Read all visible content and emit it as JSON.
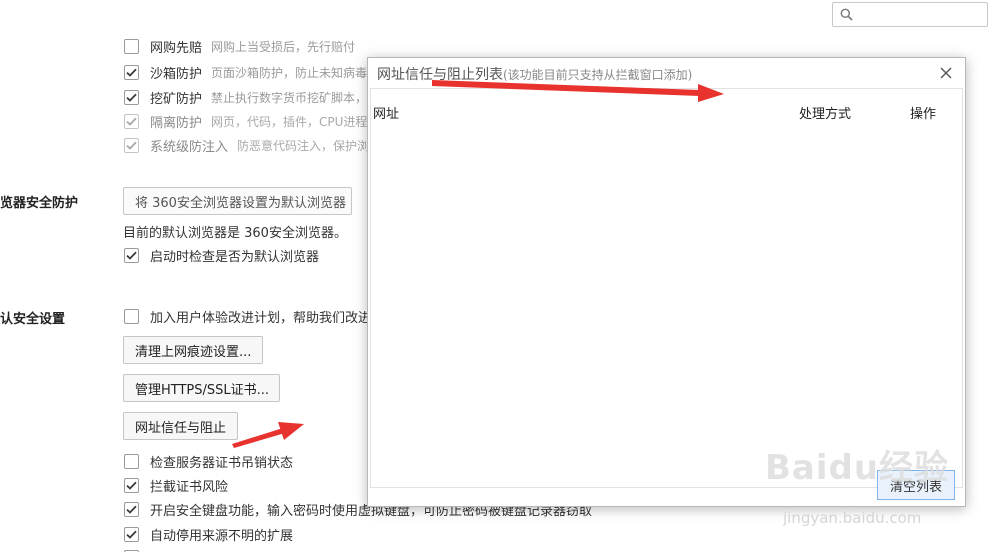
{
  "search": {
    "value": ""
  },
  "options_top": [
    {
      "name": "网购先赔",
      "desc": "网购上当受损后，先行赔付",
      "checked": false,
      "disabled": false
    },
    {
      "name": "沙箱防护",
      "desc": "页面沙箱防护，防止未知病毒",
      "checked": true,
      "disabled": false
    },
    {
      "name": "挖矿防护",
      "desc": "禁止执行数字货币挖矿脚本，",
      "checked": true,
      "disabled": false
    },
    {
      "name": "隔离防护",
      "desc": "网页，代码，插件，CPU进程",
      "checked": true,
      "disabled": true
    },
    {
      "name": "系统级防注入",
      "desc": "防恶意代码注入，保护浏",
      "checked": true,
      "disabled": true
    }
  ],
  "browser_section": {
    "title": "览器安全防护",
    "set_default_button": "将 360安全浏览器设置为默认浏览器",
    "status_text": "目前的默认浏览器是 360安全浏览器。",
    "check_on_start": {
      "label": "启动时检查是否为默认浏览器",
      "checked": true
    }
  },
  "privacy_section": {
    "title": "认安全设置",
    "join_program": {
      "label": "加入用户体验改进计划，帮助我们改进",
      "checked": false
    },
    "clear_traces_button": "清理上网痕迹设置...",
    "manage_ssl_button": "管理HTTPS/SSL证书...",
    "url_trust_button": "网址信任与阻止",
    "checks": [
      {
        "label": "检查服务器证书吊销状态",
        "checked": false
      },
      {
        "label": "拦截证书风险",
        "checked": true
      },
      {
        "label": "开启安全键盘功能，输入密码时使用虚拟键盘，可防止密码被键盘记录器窃取",
        "checked": true
      },
      {
        "label": "自动停用来源不明的扩展",
        "checked": true
      }
    ]
  },
  "dialog": {
    "title": "网址信任与阻止列表",
    "title_note": "(该功能目前只支持从拦截窗口添加)",
    "col_url": "网址",
    "col_method": "处理方式",
    "col_action": "操作",
    "clear_button": "清空列表"
  },
  "watermark": {
    "logo": "Baidu经验",
    "url": "jingyan.baidu.com"
  },
  "colors": {
    "annotation_arrow": "#e8322e",
    "check": "#3a3a3a"
  }
}
